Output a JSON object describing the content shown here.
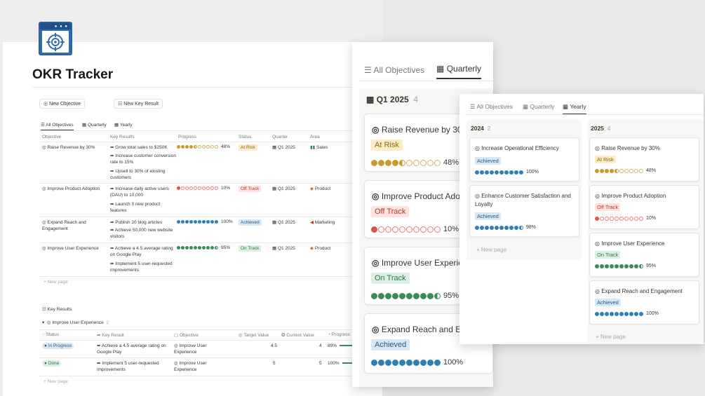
{
  "title": "OKR Tracker",
  "toolbar": {
    "new_objective": "New Objective",
    "new_key_result": "New Key Result"
  },
  "icons": {
    "target": "target-icon",
    "list": "list-icon",
    "calendar": "calendar-icon",
    "arrow": "arrow-right-icon"
  },
  "colors": {
    "gold": "#c79a2d",
    "red": "#d9534f",
    "blue": "#2f7fb5",
    "green": "#3d8b5a",
    "empty": "#cfcfcc"
  },
  "views": {
    "all": "All Objectives",
    "quarterly": "Quarterly",
    "yearly": "Yearly"
  },
  "objectives_table": {
    "headers": [
      "Objective",
      "Key Results",
      "Progress",
      "Status",
      "Quarter",
      "Area"
    ],
    "rows": [
      {
        "objective": "Raise Revenue by 30%",
        "key_results": [
          "Grow total sales to $250K",
          "Increase customer conversion rate to 15%",
          "Upsell to 30% of existing customers"
        ],
        "progress": 48,
        "status": "At Risk",
        "quarter": "Q1 2025",
        "area": "Sales"
      },
      {
        "objective": "Improve Product Adoption",
        "key_results": [
          "Increase daily active users (DAU) to 10,000",
          "Launch 3 new product features"
        ],
        "progress": 10,
        "status": "Off Track",
        "quarter": "Q1 2025",
        "area": "Product"
      },
      {
        "objective": "Expand Reach and Engagement",
        "key_results": [
          "Publish 20 blog articles",
          "Achieve 50,000 new website visitors"
        ],
        "progress": 100,
        "status": "Achieved",
        "quarter": "Q1 2025",
        "area": "Marketing"
      },
      {
        "objective": "Improve User Experience",
        "key_results": [
          "Achieve a 4.5 average rating on Google Play",
          "Implement 5 user-requested improvements"
        ],
        "progress": 95,
        "status": "On Track",
        "quarter": "Q1 2025",
        "area": "Product"
      }
    ],
    "new_page": "New page"
  },
  "key_results": {
    "title": "Key Results",
    "group": "Improve User Experience",
    "group_count": "2",
    "headers": [
      "Status",
      "Key Result",
      "Objective",
      "Target Value",
      "Current Value",
      "Progress"
    ],
    "rows": [
      {
        "status": "In Progress",
        "key_result": "Achieve a 4.5 average rating on Google Play",
        "objective": "Improve User Experience",
        "target": "4.5",
        "current": "4",
        "progress": "89%"
      },
      {
        "status": "Done",
        "key_result": "Implement 5 user-requested improvements",
        "objective": "Improve User Experience",
        "target": "5",
        "current": "5",
        "progress": "100%"
      }
    ],
    "new_page": "New page"
  },
  "quarterly": {
    "group": "Q1 2025",
    "count": "4",
    "cards": [
      {
        "title": "Raise Revenue by 30%",
        "status": "At Risk",
        "progress": 48
      },
      {
        "title": "Improve Product Adoption",
        "status": "Off Track",
        "progress": 10
      },
      {
        "title": "Improve User Experience",
        "status": "On Track",
        "progress": 95
      },
      {
        "title": "Expand Reach and Engagement",
        "status": "Achieved",
        "progress": 100
      }
    ]
  },
  "yearly": {
    "groups": [
      {
        "year": "2024",
        "count": "2",
        "cards": [
          {
            "title": "Increase Operational Efficiency",
            "status": "Achieved",
            "progress": 100
          },
          {
            "title": "Enhance Customer Satisfaction and Loyalty",
            "status": "Achieved",
            "progress": 98
          }
        ],
        "new_page": "New page"
      },
      {
        "year": "2025",
        "count": "4",
        "cards": [
          {
            "title": "Raise Revenue by 30%",
            "status": "At Risk",
            "progress": 48
          },
          {
            "title": "Improve Product Adoption",
            "status": "Off Track",
            "progress": 10
          },
          {
            "title": "Improve User Experience",
            "status": "On Track",
            "progress": 95
          },
          {
            "title": "Expand Reach and Engagement",
            "status": "Achieved",
            "progress": 100
          }
        ],
        "new_page": "New page"
      }
    ]
  }
}
